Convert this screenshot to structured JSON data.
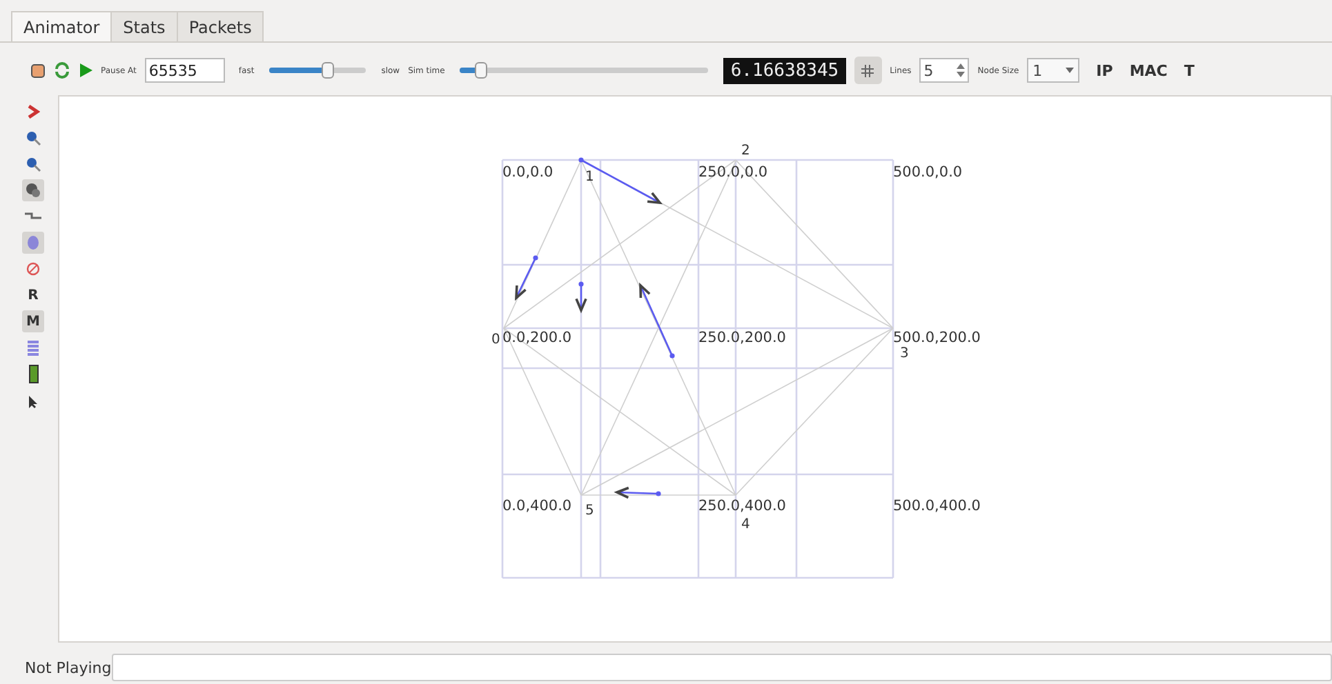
{
  "tabs": [
    {
      "label": "Animator",
      "selected": true
    },
    {
      "label": "Stats",
      "selected": false
    },
    {
      "label": "Packets",
      "selected": false
    }
  ],
  "toolbar": {
    "pause_label": "Pause At",
    "pause_value": "65535",
    "fast_label": "fast",
    "speed": {
      "level": 0.6
    },
    "slow_label": "slow",
    "sim_time_label": "Sim time",
    "sim_time": {
      "level": 0.08
    },
    "time_display": "6.16638345",
    "grid_pressed": true,
    "lines_label": "Lines",
    "lines_value": "5",
    "node_size_label": "Node Size",
    "node_size_value": "1",
    "ip": "IP",
    "mac": "MAC",
    "t": "T"
  },
  "sidebar": [
    {
      "kind": "chevron",
      "pressed": false
    },
    {
      "kind": "zoom-in",
      "pressed": false
    },
    {
      "kind": "zoom-out",
      "pressed": false
    },
    {
      "kind": "gear",
      "pressed": true
    },
    {
      "kind": "ruler",
      "pressed": false
    },
    {
      "kind": "fingerprint",
      "pressed": true
    },
    {
      "kind": "block",
      "pressed": false
    },
    {
      "kind": "letter",
      "label": "R",
      "pressed": false
    },
    {
      "kind": "letter",
      "label": "M",
      "pressed": true
    },
    {
      "kind": "list",
      "pressed": false
    },
    {
      "kind": "battery",
      "pressed": false
    },
    {
      "kind": "cursor",
      "pressed": false
    }
  ],
  "canvas": {
    "grid_labels": [
      "0.0,0.0",
      "250.0,0.0",
      "500.0,0.0",
      "0.0,200.0",
      "250.0,200.0",
      "500.0,200.0",
      "0.0,400.0",
      "250.0,400.0",
      "500.0,400.0"
    ],
    "node_ids": [
      "0",
      "1",
      "2",
      "3",
      "4",
      "5"
    ]
  },
  "status_bar": {
    "text": "Not Playing"
  }
}
